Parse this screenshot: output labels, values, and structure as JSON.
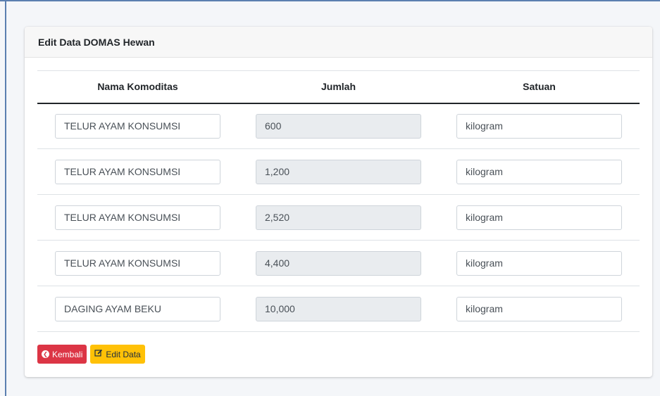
{
  "card": {
    "title": "Edit Data DOMAS Hewan"
  },
  "table": {
    "headers": [
      "Nama Komoditas",
      "Jumlah",
      "Satuan"
    ],
    "rows": [
      {
        "komoditas": "TELUR AYAM KONSUMSI",
        "jumlah": "600",
        "satuan": "kilogram"
      },
      {
        "komoditas": "TELUR AYAM KONSUMSI",
        "jumlah": "1,200",
        "satuan": "kilogram"
      },
      {
        "komoditas": "TELUR AYAM KONSUMSI",
        "jumlah": "2,520",
        "satuan": "kilogram"
      },
      {
        "komoditas": "TELUR AYAM KONSUMSI",
        "jumlah": "4,400",
        "satuan": "kilogram"
      },
      {
        "komoditas": "DAGING AYAM BEKU",
        "jumlah": "10,000",
        "satuan": "kilogram"
      }
    ]
  },
  "actions": {
    "back_label": "Kembali",
    "edit_label": "Edit Data"
  },
  "icons": {
    "back": "chevron-left-circle-icon",
    "edit": "edit-icon"
  },
  "colors": {
    "danger": "#dc3545",
    "warning": "#ffc107"
  }
}
